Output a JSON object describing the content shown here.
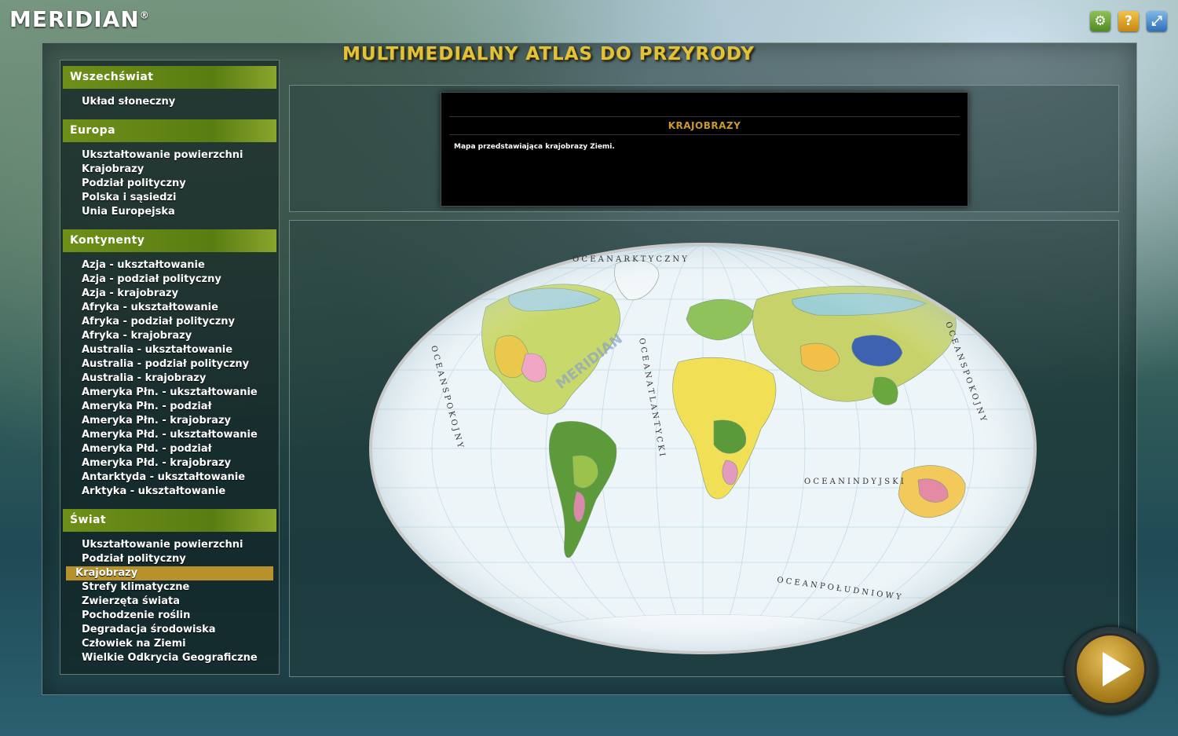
{
  "brand": {
    "name": "MERIDIAN",
    "mark": "®"
  },
  "top_icons": [
    {
      "name": "gear-icon",
      "glyph": "⚙"
    },
    {
      "name": "help-icon",
      "glyph": "?"
    },
    {
      "name": "fullscreen-icon",
      "glyph": "⤢"
    }
  ],
  "app_title": "MULTIMEDIALNY ATLAS DO PRZYRODY",
  "sidebar": {
    "sections": [
      {
        "title": "Wszechświat",
        "items": [
          "Układ słoneczny"
        ]
      },
      {
        "title": "Europa",
        "items": [
          "Ukształtowanie powierzchni",
          "Krajobrazy",
          "Podział polityczny",
          "Polska i sąsiedzi",
          "Unia Europejska"
        ]
      },
      {
        "title": "Kontynenty",
        "items": [
          "Azja - ukształtowanie",
          "Azja - podział polityczny",
          "Azja - krajobrazy",
          "Afryka - ukształtowanie",
          "Afryka - podział polityczny",
          "Afryka - krajobrazy",
          "Australia - ukształtowanie",
          "Australia - podział polityczny",
          "Australia - krajobrazy",
          "Ameryka Płn. - ukształtowanie",
          "Ameryka Płn. - podział",
          "Ameryka Płn. - krajobrazy",
          "Ameryka Płd. - ukształtowanie",
          "Ameryka Płd. - podział",
          "Ameryka Płd. - krajobrazy",
          "Antarktyda - ukształtowanie",
          "Arktyka - ukształtowanie"
        ]
      },
      {
        "title": "Świat",
        "items": [
          "Ukształtowanie powierzchni",
          "Podział polityczny",
          "Krajobrazy",
          "Strefy klimatyczne",
          "Zwierzęta świata",
          "Pochodzenie roślin",
          "Degradacja środowiska",
          "Człowiek na Ziemi",
          "Wielkie Odkrycia Geograficzne"
        ]
      }
    ],
    "active": {
      "section": 3,
      "item": 2
    }
  },
  "description": {
    "title": "KRAJOBRAZY",
    "text": "Mapa przedstawiająca krajobrazy Ziemi."
  },
  "map": {
    "ocean_labels": {
      "arctic": "O C E A N   A R K T Y C Z N Y",
      "pacific_left": "O C E A N   S P O K O J N Y",
      "atlantic": "O C E A N   A T L A N T Y C K I",
      "indian": "O C E A N   I N D Y J S K I",
      "pacific_right": "O C E A N   S P O K O J N Y",
      "southern": "O C E A N   P O Ł U D N I O W Y"
    },
    "watermark": "MERIDIAN"
  },
  "colors": {
    "header_green": "#6e8f18",
    "active_gold": "#b7922c",
    "title_gold": "#e3c23b"
  }
}
